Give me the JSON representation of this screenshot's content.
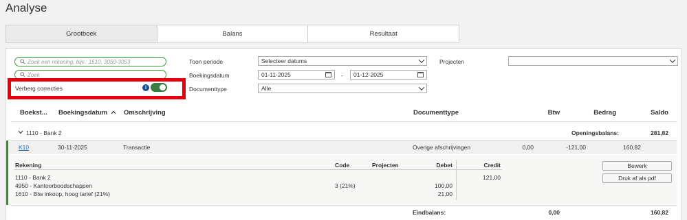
{
  "page": {
    "title": "Analyse"
  },
  "tabs": [
    {
      "label": "Grootboek"
    },
    {
      "label": "Balans"
    },
    {
      "label": "Resultaat"
    }
  ],
  "filters": {
    "search_account_placeholder": "Zoek een rekening, bijv.: 1510, 3050-3053",
    "search_placeholder": "Zoek",
    "hide_corrections_label": "Verberg correcties",
    "info_glyph": "i",
    "period_label": "Toon periode",
    "period_value": "Selecteer datums",
    "booking_date_label": "Boekingsdatum",
    "date_from": "01-11-2025",
    "date_separator": "-",
    "date_to": "01-12-2025",
    "doctype_label": "Documenttype",
    "doctype_value": "Alle",
    "projects_label": "Projecten",
    "projects_value": ""
  },
  "table": {
    "headers": {
      "boekstuk": "Boekst...",
      "boekingsdatum": "Boekingsdatum",
      "omschrijving": "Omschrijving",
      "documenttype": "Documenttype",
      "btw": "Btw",
      "bedrag": "Bedrag",
      "saldo": "Saldo"
    },
    "group": {
      "name": "1110 - Bank 2",
      "opening_label": "Openingsbalans:",
      "opening_value": "281,82"
    },
    "row": {
      "boekstuk": "K10",
      "datum": "30-11-2025",
      "omschrijving": "Transactie",
      "documenttype": "Overige afschrijvingen",
      "btw": "0,00",
      "bedrag": "-121,00",
      "saldo": "160,82"
    },
    "detail": {
      "headers": {
        "rekening": "Rekening",
        "code": "Code",
        "projecten": "Projecten",
        "debet": "Debet",
        "credit": "Credit"
      },
      "lines": [
        {
          "rekening": "1110 - Bank 2",
          "code": "",
          "debet": "",
          "credit": "121,00"
        },
        {
          "rekening": "4950 - Kantoorboodschappen",
          "code": "3 (21%)",
          "debet": "100,00",
          "credit": ""
        },
        {
          "rekening": "1610 - Btw inkoop, hoog tarief (21%)",
          "code": "",
          "debet": "21,00",
          "credit": ""
        }
      ],
      "edit_button": "Bewerk",
      "print_button": "Druk af als pdf"
    },
    "footer": {
      "end_label": "Eindbalans:",
      "btw": "0,00",
      "saldo": "160,82"
    }
  },
  "colors": {
    "accent_green": "#3a8a2e",
    "highlight_red": "#e8000f",
    "link_blue": "#1d6fb8"
  }
}
